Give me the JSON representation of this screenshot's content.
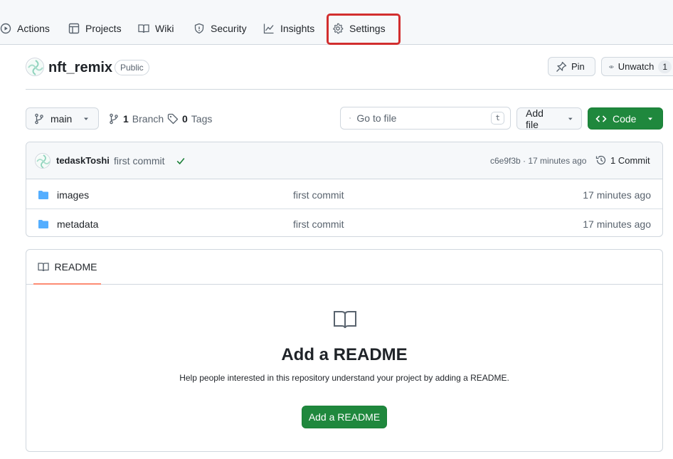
{
  "nav": {
    "actions": "Actions",
    "projects": "Projects",
    "wiki": "Wiki",
    "security": "Security",
    "insights": "Insights",
    "settings": "Settings"
  },
  "repo": {
    "name": "nft_remix",
    "visibility": "Public",
    "pin_label": "Pin",
    "unwatch_label": "Unwatch",
    "watch_count": "1"
  },
  "toolbar": {
    "branch": "main",
    "branch_count": "1",
    "branch_label": "Branch",
    "tag_count": "0",
    "tag_label": "Tags",
    "search_placeholder": "Go to file",
    "search_shortcut": "t",
    "add_file_label": "Add file",
    "code_label": "Code"
  },
  "commit": {
    "author": "tedaskToshi",
    "message": "first commit",
    "hash_time": "c6e9f3b · 17 minutes ago",
    "commit_count_label": "1 Commit"
  },
  "files": [
    {
      "name": "images",
      "message": "first commit",
      "time": "17 minutes ago"
    },
    {
      "name": "metadata",
      "message": "first commit",
      "time": "17 minutes ago"
    }
  ],
  "readme": {
    "tab_label": "README",
    "title": "Add a README",
    "description": "Help people interested in this repository understand your project by adding a README.",
    "button_label": "Add a README"
  },
  "colors": {
    "accent_green": "#1f883d",
    "folder_blue": "#54aeff",
    "highlight_red": "#d22e2e",
    "tab_underline": "#fd8c73",
    "check_green": "#1a7f37"
  }
}
